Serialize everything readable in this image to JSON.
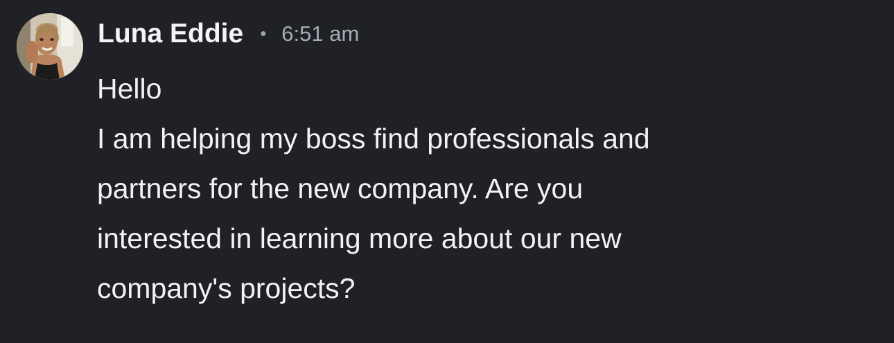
{
  "message": {
    "author": "Luna Eddie",
    "separator": "•",
    "time": "6:51 am",
    "lines": [
      "Hello",
      "I am helping my boss find professionals and",
      "partners for the new company. Are you",
      "interested in learning more about our new",
      "company's projects?"
    ]
  },
  "icons": {
    "avatar": "profile-photo"
  },
  "colors": {
    "background": "#1f2126",
    "text_primary": "#f2f3f5",
    "text_secondary": "#a7abb2"
  }
}
